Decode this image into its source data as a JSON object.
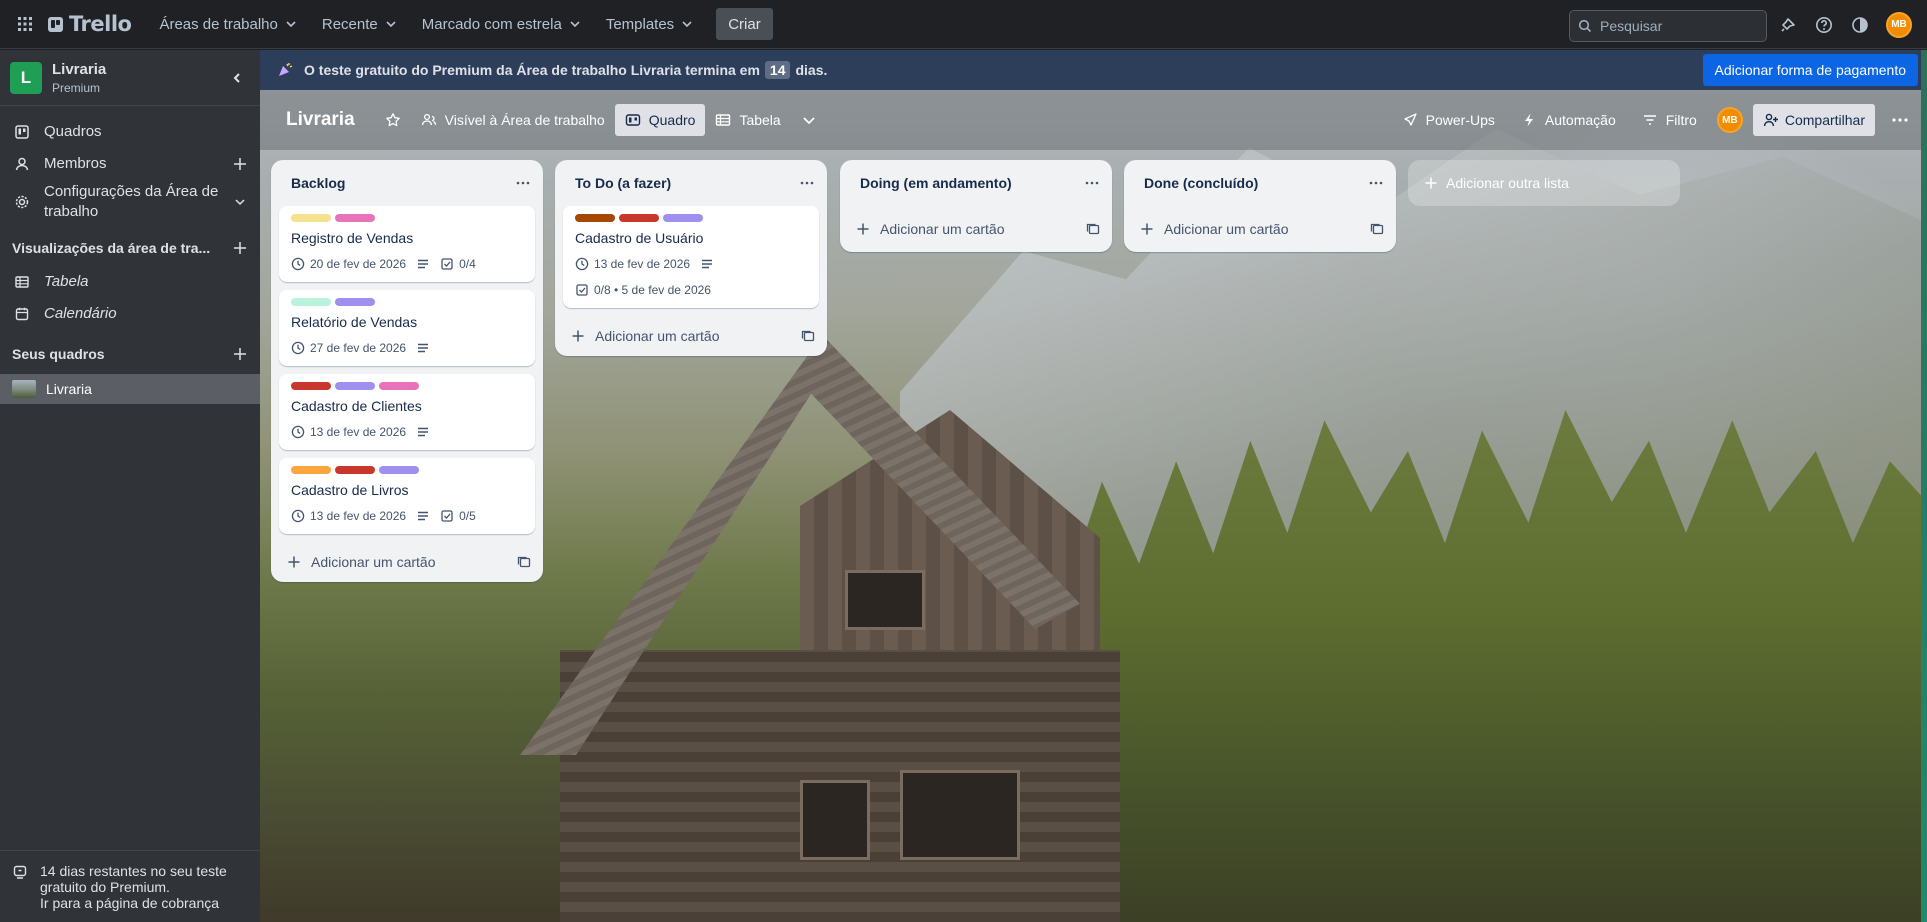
{
  "topbar": {
    "logo": "Trello",
    "menus": [
      "Áreas de trabalho",
      "Recente",
      "Marcado com estrela",
      "Templates"
    ],
    "create": "Criar",
    "search_placeholder": "Pesquisar",
    "avatar": "MB"
  },
  "sidebar": {
    "workspace_initial": "L",
    "workspace_name": "Livraria",
    "workspace_plan": "Premium",
    "items": [
      {
        "label": "Quadros",
        "icon": "board-icon"
      },
      {
        "label": "Membros",
        "icon": "members-icon"
      },
      {
        "label": "Configurações da Área de trabalho",
        "icon": "settings-icon"
      }
    ],
    "views_title": "Visualizações da área de tra...",
    "views": [
      {
        "label": "Tabela",
        "icon": "table-icon"
      },
      {
        "label": "Calendário",
        "icon": "calendar-icon"
      }
    ],
    "boards_title": "Seus quadros",
    "boards": [
      "Livraria"
    ],
    "trial_note": [
      "14 dias restantes no seu teste",
      "gratuito do Premium.",
      "Ir para a página de cobrança"
    ]
  },
  "banner": {
    "text_before": "O teste gratuito do Premium da Área de trabalho Livraria termina em",
    "days": "14",
    "text_after": "dias.",
    "button": "Adicionar forma de pagamento"
  },
  "board_header": {
    "name": "Livraria",
    "visibility": "Visível à Área de trabalho",
    "views": [
      "Quadro",
      "Tabela"
    ],
    "powerups": "Power-Ups",
    "automation": "Automação",
    "filter": "Filtro",
    "avatar": "MB",
    "share": "Compartilhar"
  },
  "lists": [
    {
      "title": "Backlog",
      "cards": [
        {
          "title": "Registro de Vendas",
          "labels": [
            "#f5e28f",
            "#e774bb"
          ],
          "date": "20 de fev de 2026",
          "description": true,
          "checklist": "0/4"
        },
        {
          "title": "Relatório de Vendas",
          "labels": [
            "#baf3db",
            "#9f8fef"
          ],
          "date": "27 de fev de 2026",
          "description": true,
          "checklist": ""
        },
        {
          "title": "Cadastro de Clientes",
          "labels": [
            "#c9372c",
            "#9f8fef",
            "#e774bb"
          ],
          "date": "13 de fev de 2026",
          "description": true,
          "checklist": ""
        },
        {
          "title": "Cadastro de Livros",
          "labels": [
            "#faa53d",
            "#c9372c",
            "#9f8fef"
          ],
          "date": "13 de fev de 2026",
          "description": true,
          "checklist": "0/5"
        }
      ],
      "add": "Adicionar um cartão"
    },
    {
      "title": "To Do (a fazer)",
      "cards": [
        {
          "title": "Cadastro de Usuário",
          "labels": [
            "#a54800",
            "#c9372c",
            "#9f8fef"
          ],
          "date": "13 de fev de 2026",
          "description": true,
          "checklist_line": "0/8 • 5 de fev de 2026"
        }
      ],
      "add": "Adicionar um cartão"
    },
    {
      "title": "Doing (em andamento)",
      "cards": [],
      "add": "Adicionar um cartão"
    },
    {
      "title": "Done (concluído)",
      "cards": [],
      "add": "Adicionar um cartão"
    }
  ],
  "add_list": "Adicionar outra lista"
}
